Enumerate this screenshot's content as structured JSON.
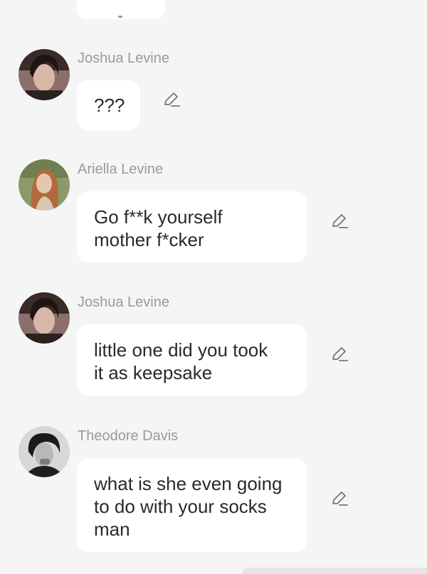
{
  "messages": [
    {
      "sender": "Joshua Levine",
      "lines": [
        "???"
      ]
    },
    {
      "sender": "Ariella Levine",
      "lines": [
        "Go f**k yourself",
        "mother f*cker"
      ]
    },
    {
      "sender": "Joshua Levine",
      "lines": [
        "little one did you took",
        "it as keepsake"
      ]
    },
    {
      "sender": "Theodore Davis",
      "lines": [
        "what is she even going",
        "to do with your socks",
        "man"
      ]
    }
  ],
  "colors": {
    "background": "#f5f5f5",
    "bubble": "#ffffff",
    "sender_name": "#9a9a9a",
    "message_text": "#2a2a2a",
    "edit_icon": "#777777"
  },
  "icons": {
    "edit": "pencil-edit-icon"
  }
}
